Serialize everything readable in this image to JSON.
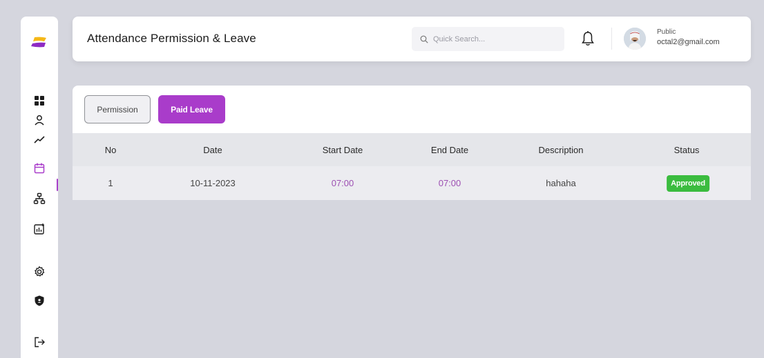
{
  "header": {
    "title": "Attendance Permission & Leave",
    "search_placeholder": "Quick Search...",
    "user_role": "Public",
    "user_email": "octal2@gmail.com"
  },
  "tabs": {
    "permission": "Permission",
    "paid_leave": "Paid Leave"
  },
  "table": {
    "columns": [
      "No",
      "Date",
      "Start Date",
      "End Date",
      "Description",
      "Status"
    ],
    "rows": [
      {
        "no": "1",
        "date": "10-11-2023",
        "start": "07:00",
        "end": "07:00",
        "description": "hahaha",
        "status": "Approved"
      }
    ]
  },
  "sidebar": {
    "items": [
      "dashboard-icon",
      "user-icon",
      "trend-icon",
      "calendar-icon",
      "org-chart-icon",
      "report-icon",
      "settings-icon",
      "shield-icon",
      "logout-icon"
    ],
    "active": "calendar-icon"
  },
  "colors": {
    "accent": "#a93cca",
    "approved": "#3bbc3f",
    "logo_yellow": "#f5b818",
    "logo_purple": "#8e2bc4"
  }
}
